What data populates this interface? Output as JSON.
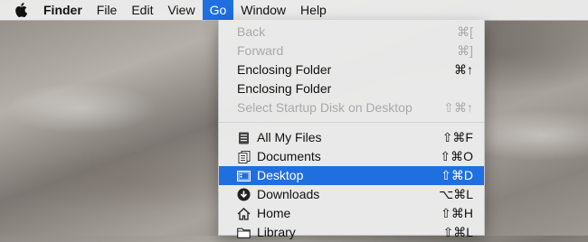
{
  "menubar": {
    "items": [
      "Finder",
      "File",
      "Edit",
      "View",
      "Go",
      "Window",
      "Help"
    ]
  },
  "go_menu": {
    "items": [
      {
        "label": "Back",
        "shortcut": "⌘[",
        "enabled": false
      },
      {
        "label": "Forward",
        "shortcut": "⌘]",
        "enabled": false
      },
      {
        "label": "Enclosing Folder",
        "shortcut": "⌘↑",
        "enabled": true
      },
      {
        "label": "Enclosing Folder",
        "shortcut": "",
        "enabled": true
      },
      {
        "label": "Select Startup Disk on Desktop",
        "shortcut": "⇧⌘↑",
        "enabled": false
      },
      {
        "label": "All My Files",
        "shortcut": "⇧⌘F",
        "icon": "all-files-icon"
      },
      {
        "label": "Documents",
        "shortcut": "⇧⌘O",
        "icon": "documents-icon"
      },
      {
        "label": "Desktop",
        "shortcut": "⇧⌘D",
        "icon": "desktop-icon",
        "highlighted": true
      },
      {
        "label": "Downloads",
        "shortcut": "⌥⌘L",
        "icon": "downloads-icon"
      },
      {
        "label": "Home",
        "shortcut": "⇧⌘H",
        "icon": "home-icon"
      },
      {
        "label": "Library",
        "shortcut": "⇧⌘L",
        "icon": "library-icon"
      }
    ]
  },
  "colors": {
    "highlight": "#1f6fe0",
    "disabled_text": "#a9a9a9"
  }
}
